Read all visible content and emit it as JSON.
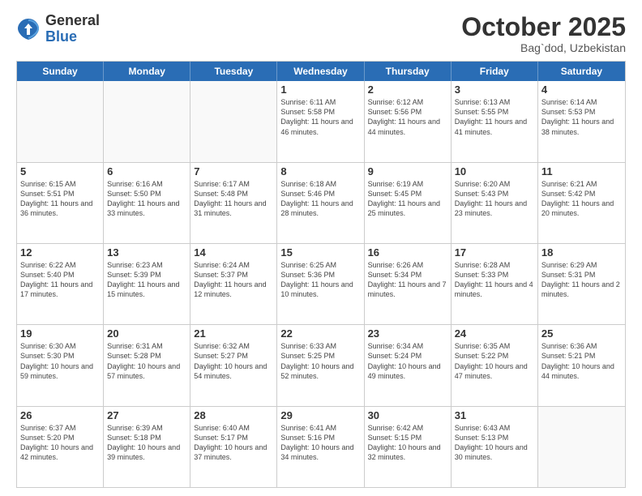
{
  "logo": {
    "general": "General",
    "blue": "Blue"
  },
  "header": {
    "month": "October 2025",
    "location": "Bag`dod, Uzbekistan"
  },
  "weekdays": [
    "Sunday",
    "Monday",
    "Tuesday",
    "Wednesday",
    "Thursday",
    "Friday",
    "Saturday"
  ],
  "weeks": [
    [
      {
        "day": "",
        "sunrise": "",
        "sunset": "",
        "daylight": "",
        "empty": true
      },
      {
        "day": "",
        "sunrise": "",
        "sunset": "",
        "daylight": "",
        "empty": true
      },
      {
        "day": "",
        "sunrise": "",
        "sunset": "",
        "daylight": "",
        "empty": true
      },
      {
        "day": "1",
        "sunrise": "Sunrise: 6:11 AM",
        "sunset": "Sunset: 5:58 PM",
        "daylight": "Daylight: 11 hours and 46 minutes.",
        "empty": false
      },
      {
        "day": "2",
        "sunrise": "Sunrise: 6:12 AM",
        "sunset": "Sunset: 5:56 PM",
        "daylight": "Daylight: 11 hours and 44 minutes.",
        "empty": false
      },
      {
        "day": "3",
        "sunrise": "Sunrise: 6:13 AM",
        "sunset": "Sunset: 5:55 PM",
        "daylight": "Daylight: 11 hours and 41 minutes.",
        "empty": false
      },
      {
        "day": "4",
        "sunrise": "Sunrise: 6:14 AM",
        "sunset": "Sunset: 5:53 PM",
        "daylight": "Daylight: 11 hours and 38 minutes.",
        "empty": false
      }
    ],
    [
      {
        "day": "5",
        "sunrise": "Sunrise: 6:15 AM",
        "sunset": "Sunset: 5:51 PM",
        "daylight": "Daylight: 11 hours and 36 minutes.",
        "empty": false
      },
      {
        "day": "6",
        "sunrise": "Sunrise: 6:16 AM",
        "sunset": "Sunset: 5:50 PM",
        "daylight": "Daylight: 11 hours and 33 minutes.",
        "empty": false
      },
      {
        "day": "7",
        "sunrise": "Sunrise: 6:17 AM",
        "sunset": "Sunset: 5:48 PM",
        "daylight": "Daylight: 11 hours and 31 minutes.",
        "empty": false
      },
      {
        "day": "8",
        "sunrise": "Sunrise: 6:18 AM",
        "sunset": "Sunset: 5:46 PM",
        "daylight": "Daylight: 11 hours and 28 minutes.",
        "empty": false
      },
      {
        "day": "9",
        "sunrise": "Sunrise: 6:19 AM",
        "sunset": "Sunset: 5:45 PM",
        "daylight": "Daylight: 11 hours and 25 minutes.",
        "empty": false
      },
      {
        "day": "10",
        "sunrise": "Sunrise: 6:20 AM",
        "sunset": "Sunset: 5:43 PM",
        "daylight": "Daylight: 11 hours and 23 minutes.",
        "empty": false
      },
      {
        "day": "11",
        "sunrise": "Sunrise: 6:21 AM",
        "sunset": "Sunset: 5:42 PM",
        "daylight": "Daylight: 11 hours and 20 minutes.",
        "empty": false
      }
    ],
    [
      {
        "day": "12",
        "sunrise": "Sunrise: 6:22 AM",
        "sunset": "Sunset: 5:40 PM",
        "daylight": "Daylight: 11 hours and 17 minutes.",
        "empty": false
      },
      {
        "day": "13",
        "sunrise": "Sunrise: 6:23 AM",
        "sunset": "Sunset: 5:39 PM",
        "daylight": "Daylight: 11 hours and 15 minutes.",
        "empty": false
      },
      {
        "day": "14",
        "sunrise": "Sunrise: 6:24 AM",
        "sunset": "Sunset: 5:37 PM",
        "daylight": "Daylight: 11 hours and 12 minutes.",
        "empty": false
      },
      {
        "day": "15",
        "sunrise": "Sunrise: 6:25 AM",
        "sunset": "Sunset: 5:36 PM",
        "daylight": "Daylight: 11 hours and 10 minutes.",
        "empty": false
      },
      {
        "day": "16",
        "sunrise": "Sunrise: 6:26 AM",
        "sunset": "Sunset: 5:34 PM",
        "daylight": "Daylight: 11 hours and 7 minutes.",
        "empty": false
      },
      {
        "day": "17",
        "sunrise": "Sunrise: 6:28 AM",
        "sunset": "Sunset: 5:33 PM",
        "daylight": "Daylight: 11 hours and 4 minutes.",
        "empty": false
      },
      {
        "day": "18",
        "sunrise": "Sunrise: 6:29 AM",
        "sunset": "Sunset: 5:31 PM",
        "daylight": "Daylight: 11 hours and 2 minutes.",
        "empty": false
      }
    ],
    [
      {
        "day": "19",
        "sunrise": "Sunrise: 6:30 AM",
        "sunset": "Sunset: 5:30 PM",
        "daylight": "Daylight: 10 hours and 59 minutes.",
        "empty": false
      },
      {
        "day": "20",
        "sunrise": "Sunrise: 6:31 AM",
        "sunset": "Sunset: 5:28 PM",
        "daylight": "Daylight: 10 hours and 57 minutes.",
        "empty": false
      },
      {
        "day": "21",
        "sunrise": "Sunrise: 6:32 AM",
        "sunset": "Sunset: 5:27 PM",
        "daylight": "Daylight: 10 hours and 54 minutes.",
        "empty": false
      },
      {
        "day": "22",
        "sunrise": "Sunrise: 6:33 AM",
        "sunset": "Sunset: 5:25 PM",
        "daylight": "Daylight: 10 hours and 52 minutes.",
        "empty": false
      },
      {
        "day": "23",
        "sunrise": "Sunrise: 6:34 AM",
        "sunset": "Sunset: 5:24 PM",
        "daylight": "Daylight: 10 hours and 49 minutes.",
        "empty": false
      },
      {
        "day": "24",
        "sunrise": "Sunrise: 6:35 AM",
        "sunset": "Sunset: 5:22 PM",
        "daylight": "Daylight: 10 hours and 47 minutes.",
        "empty": false
      },
      {
        "day": "25",
        "sunrise": "Sunrise: 6:36 AM",
        "sunset": "Sunset: 5:21 PM",
        "daylight": "Daylight: 10 hours and 44 minutes.",
        "empty": false
      }
    ],
    [
      {
        "day": "26",
        "sunrise": "Sunrise: 6:37 AM",
        "sunset": "Sunset: 5:20 PM",
        "daylight": "Daylight: 10 hours and 42 minutes.",
        "empty": false
      },
      {
        "day": "27",
        "sunrise": "Sunrise: 6:39 AM",
        "sunset": "Sunset: 5:18 PM",
        "daylight": "Daylight: 10 hours and 39 minutes.",
        "empty": false
      },
      {
        "day": "28",
        "sunrise": "Sunrise: 6:40 AM",
        "sunset": "Sunset: 5:17 PM",
        "daylight": "Daylight: 10 hours and 37 minutes.",
        "empty": false
      },
      {
        "day": "29",
        "sunrise": "Sunrise: 6:41 AM",
        "sunset": "Sunset: 5:16 PM",
        "daylight": "Daylight: 10 hours and 34 minutes.",
        "empty": false
      },
      {
        "day": "30",
        "sunrise": "Sunrise: 6:42 AM",
        "sunset": "Sunset: 5:15 PM",
        "daylight": "Daylight: 10 hours and 32 minutes.",
        "empty": false
      },
      {
        "day": "31",
        "sunrise": "Sunrise: 6:43 AM",
        "sunset": "Sunset: 5:13 PM",
        "daylight": "Daylight: 10 hours and 30 minutes.",
        "empty": false
      },
      {
        "day": "",
        "sunrise": "",
        "sunset": "",
        "daylight": "",
        "empty": true
      }
    ]
  ]
}
